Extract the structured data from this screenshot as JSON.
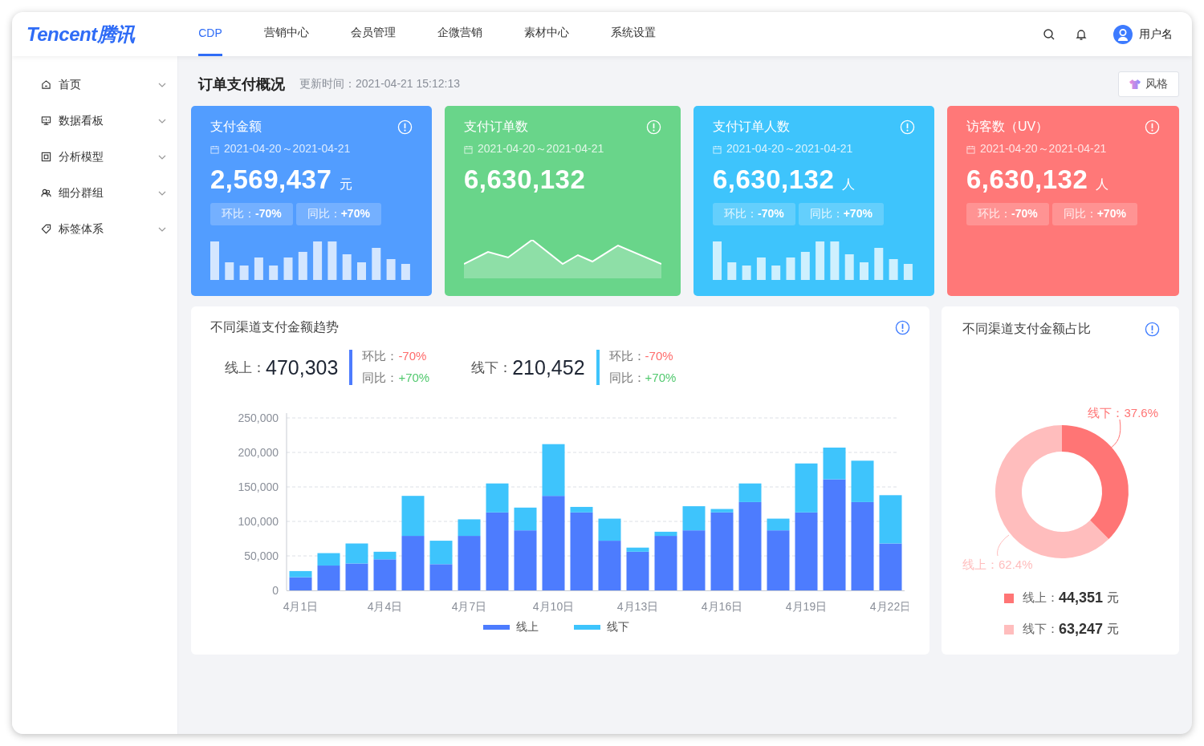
{
  "header": {
    "logo": "Tencent腾讯",
    "tabs": [
      {
        "label": "CDP",
        "selected": true
      },
      {
        "label": "营销中心",
        "selected": false
      },
      {
        "label": "会员管理",
        "selected": false
      },
      {
        "label": "企微营销",
        "selected": false
      },
      {
        "label": "素材中心",
        "selected": false
      },
      {
        "label": "系统设置",
        "selected": false
      }
    ],
    "user": "用户名"
  },
  "sidebar": {
    "items": [
      {
        "label": "首页"
      },
      {
        "label": "数据看板"
      },
      {
        "label": "分析模型"
      },
      {
        "label": "细分群组"
      },
      {
        "label": "标签体系"
      }
    ]
  },
  "page": {
    "title": "订单支付概况",
    "updated": "更新时间：2021-04-21 15:12:13",
    "style_button": "风格"
  },
  "kpi_cards": [
    {
      "title": "支付金额",
      "date": "2021-04-20～2021-04-21",
      "value": "2,569,437",
      "unit": "元",
      "color": "#529dff",
      "kind": "bars",
      "badges": [
        {
          "label": "环比：",
          "value": "-70%"
        },
        {
          "label": "同比：",
          "value": "+70%"
        }
      ]
    },
    {
      "title": "支付订单数",
      "date": "2021-04-20～2021-04-21",
      "value": "6,630,132",
      "color": "#69d58a",
      "kind": "area"
    },
    {
      "title": "支付订单人数",
      "date": "2021-04-20～2021-04-21",
      "value": "6,630,132",
      "unit": "人",
      "color": "#3ec4fc",
      "kind": "bars",
      "badges": [
        {
          "label": "环比：",
          "value": "-70%"
        },
        {
          "label": "同比：",
          "value": "+70%"
        }
      ]
    },
    {
      "title": "访客数（UV）",
      "date": "2021-04-20～2021-04-21",
      "value": "6,630,132",
      "unit": "人",
      "color": "#ff7878",
      "kind": "none",
      "badges": [
        {
          "label": "环比：",
          "value": "-70%"
        },
        {
          "label": "同比：",
          "value": "+70%"
        }
      ]
    }
  ],
  "trend_card": {
    "title": "不同渠道支付金额趋势",
    "summary": [
      {
        "label": "线上：",
        "value": "470,303",
        "color": "#4d7cfe",
        "compare": [
          {
            "label": "环比：",
            "value": "-70%",
            "kind": "down"
          },
          {
            "label": "同比：",
            "value": "+70%",
            "kind": "up"
          }
        ]
      },
      {
        "label": "线下：",
        "value": "210,452",
        "color": "#3ec4fc",
        "compare": [
          {
            "label": "环比：",
            "value": "-70%",
            "kind": "down"
          },
          {
            "label": "同比：",
            "value": "+70%",
            "kind": "up"
          }
        ]
      }
    ],
    "chart_data": {
      "type": "bar",
      "stacked": true,
      "grid": true,
      "legend": "bottom",
      "categories": [
        "4月1日",
        null,
        null,
        "4月4日",
        null,
        null,
        "4月7日",
        null,
        null,
        "4月10日",
        null,
        null,
        "4月13日",
        null,
        null,
        "4月16日",
        null,
        null,
        "4月19日",
        null,
        null,
        "4月22日"
      ],
      "ylim": [
        0,
        250000
      ],
      "yticks": [
        {
          "value": 0,
          "label": "0"
        },
        {
          "value": 50000,
          "label": "50,000"
        },
        {
          "value": 100000,
          "label": "100,000"
        },
        {
          "value": 150000,
          "label": "150,000"
        },
        {
          "value": 200000,
          "label": "200,000"
        },
        {
          "value": 250000,
          "label": "250,000"
        }
      ],
      "series": [
        {
          "name": "线上",
          "color": "#4d7cfe",
          "values": [
            19000,
            36000,
            39000,
            45000,
            79000,
            38000,
            79000,
            113000,
            87000,
            137000,
            113000,
            72000,
            56000,
            79000,
            87000,
            113000,
            128000,
            87000,
            113000,
            161000,
            128000,
            68000
          ]
        },
        {
          "name": "线下",
          "color": "#3ec4fc",
          "values": [
            9000,
            18000,
            29000,
            11000,
            58000,
            34000,
            24000,
            42000,
            33000,
            75000,
            8000,
            32000,
            6000,
            6000,
            35000,
            5000,
            27000,
            17000,
            71000,
            46000,
            60000,
            70000
          ]
        }
      ]
    }
  },
  "share_card": {
    "title": "不同渠道支付金额占比",
    "chart_data": {
      "type": "donut",
      "values": [
        62.4,
        37.6
      ],
      "colors": [
        "#ffbdbd",
        "#ff7575"
      ],
      "value_labels": [
        "线上：62.4%",
        "线下：37.6%"
      ]
    },
    "legend": [
      {
        "label": "线上：",
        "value": "44,351",
        "unit": "元",
        "color": "#ff7575"
      },
      {
        "label": "线下：",
        "value": "63,247",
        "unit": "元",
        "color": "#ffbdbd"
      }
    ]
  }
}
